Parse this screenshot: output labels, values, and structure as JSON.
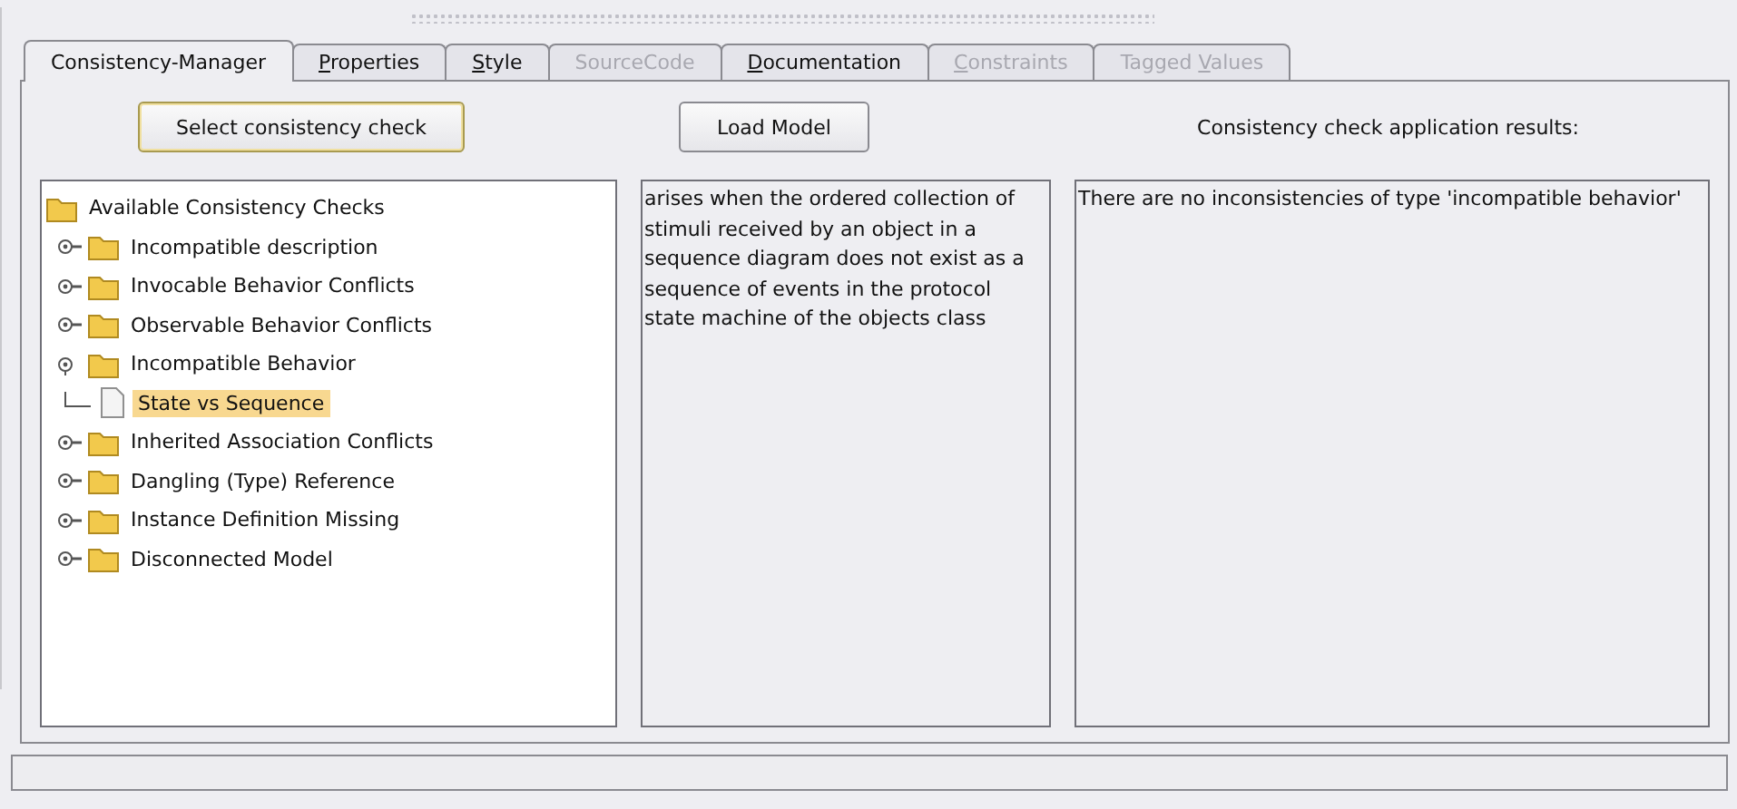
{
  "tabs": [
    {
      "label": "Consistency-Manager",
      "selected": true,
      "disabled": false
    },
    {
      "mnemonic": "P",
      "label_rest": "roperties",
      "selected": false,
      "disabled": false
    },
    {
      "mnemonic": "S",
      "label_rest": "tyle",
      "selected": false,
      "disabled": false
    },
    {
      "label": "SourceCode",
      "selected": false,
      "disabled": true
    },
    {
      "mnemonic": "D",
      "label_rest": "ocumentation",
      "selected": false,
      "disabled": false
    },
    {
      "mnemonic": "C",
      "label_rest": "onstraints",
      "selected": false,
      "disabled": true
    },
    {
      "label": "Tagged ",
      "mnemonic": "V",
      "label_rest": "alues",
      "selected": false,
      "disabled": true
    }
  ],
  "buttons": [
    {
      "label": "Select consistency check",
      "focused": true
    },
    {
      "label": "Load Model",
      "focused": false
    }
  ],
  "results_label": "Consistency check application results:",
  "tree": {
    "label": "Available Consistency Checks",
    "children": [
      {
        "label": "Incompatible description",
        "expanded": false,
        "selected": false
      },
      {
        "label": "Invocable Behavior Conflicts",
        "expanded": false,
        "selected": false
      },
      {
        "label": "Observable Behavior Conflicts",
        "expanded": false,
        "selected": false
      },
      {
        "label": "Incompatible Behavior",
        "expanded": true,
        "selected": false,
        "children": [
          {
            "label": "State vs Sequence",
            "selected": true
          }
        ]
      },
      {
        "label": "Inherited Association Conflicts",
        "expanded": false,
        "selected": false
      },
      {
        "label": "Dangling (Type) Reference",
        "expanded": false,
        "selected": false
      },
      {
        "label": "Instance Definition Missing",
        "expanded": false,
        "selected": false
      },
      {
        "label": "Disconnected Model",
        "expanded": false,
        "selected": false
      }
    ]
  },
  "description": "arises when the ordered collection of stimuli received by an object in a sequence diagram does not exist as a sequence of events in the protocol state machine of the objects class",
  "results": "There are no inconsistencies of type 'incompatible behavior'"
}
